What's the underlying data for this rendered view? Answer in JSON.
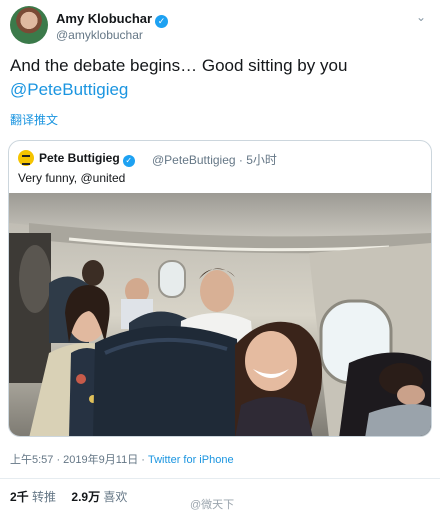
{
  "author": {
    "name": "Amy Klobuchar",
    "handle": "@amyklobuchar",
    "verified_icon": "verified-badge-icon",
    "menu_icon": "chevron-down-icon"
  },
  "tweet": {
    "text": "And the debate begins…  Good sitting by you",
    "mention": "@PeteButtigieg",
    "translate_label": "翻译推文"
  },
  "quoted": {
    "name": "Pete Buttigieg",
    "handle_time": "@PeteButtigieg · 5小时",
    "text": "Very funny, @united",
    "photo_description_icon": "airplane-cabin-photo"
  },
  "meta": {
    "time_date": "上午5:57 · 2019年9月11日 · ",
    "source": "Twitter for iPhone"
  },
  "stats": {
    "retweets_count": "2千",
    "retweets_label": "转推",
    "likes_count": "2.9万",
    "likes_label": "喜欢"
  },
  "watermark": "@微天下",
  "colors": {
    "link": "#1b95e0",
    "verified": "#1da1f2",
    "secondary_text": "#657786",
    "border": "#ccd6dd"
  }
}
